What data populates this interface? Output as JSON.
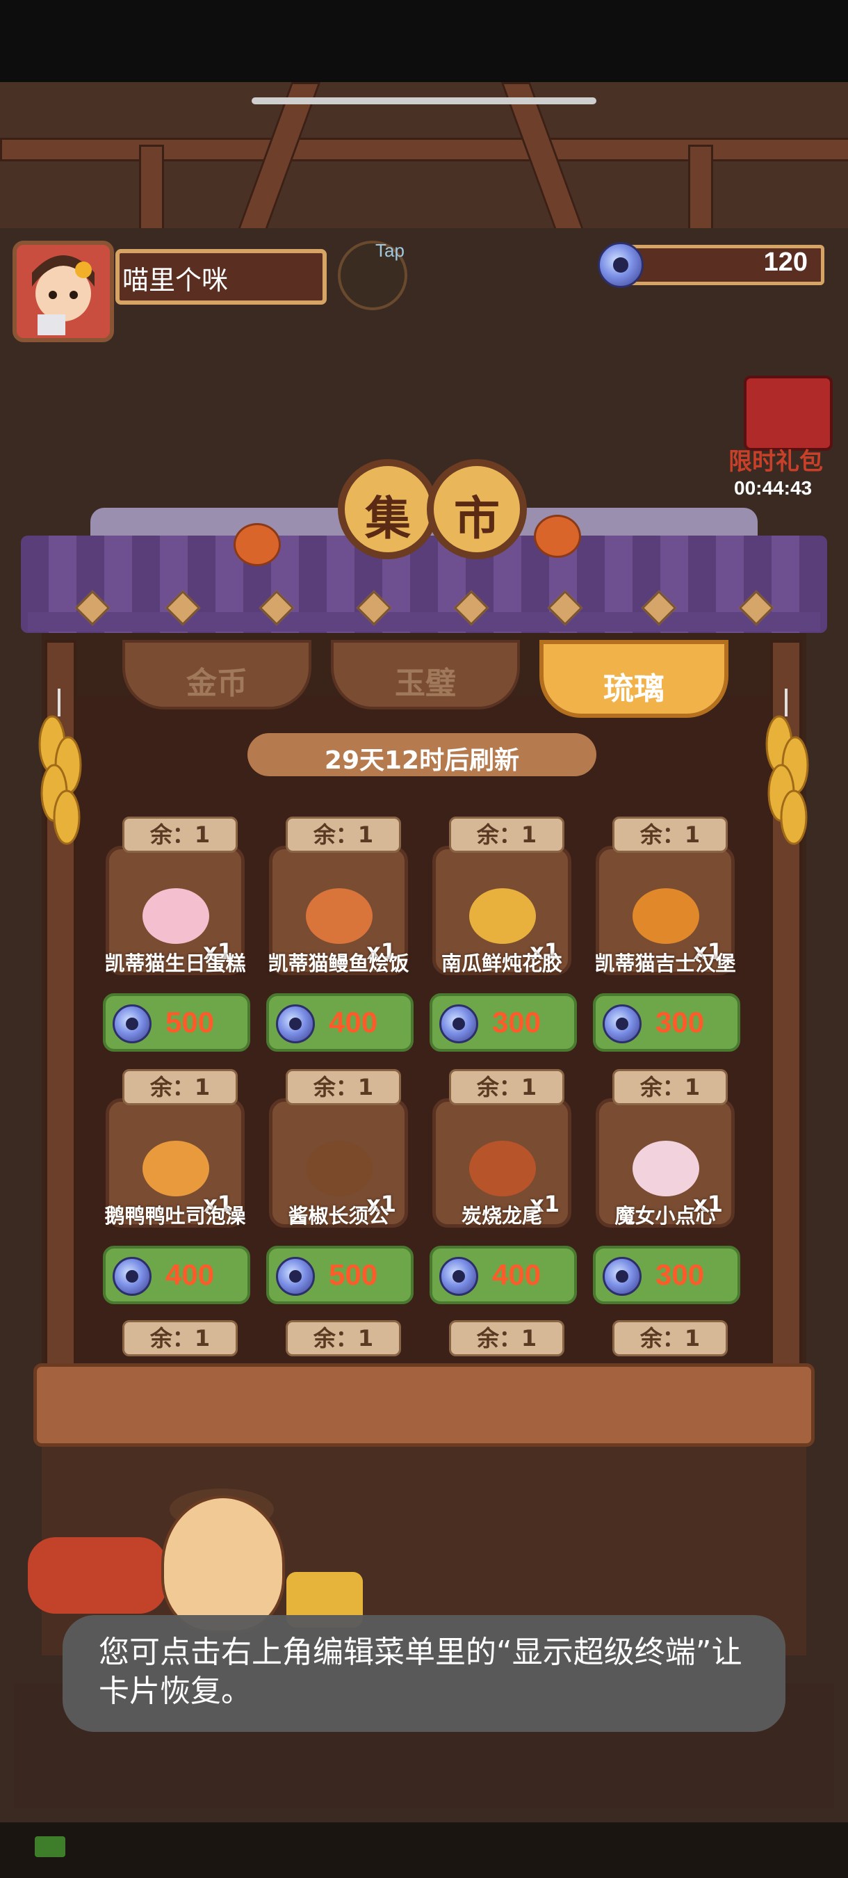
{
  "player": {
    "name": "喵里个咪",
    "tap_label": "Tap"
  },
  "currency": {
    "icon": "glass-coin-icon",
    "value": "120"
  },
  "gift": {
    "label": "限时礼包",
    "timer": "00:44:43"
  },
  "shop": {
    "title_chars": [
      "集",
      "市"
    ],
    "tabs": [
      {
        "label": "金币",
        "active": false
      },
      {
        "label": "玉璧",
        "active": false
      },
      {
        "label": "琉璃",
        "active": true
      }
    ],
    "refresh_text": "29天12时后刷新",
    "items": [
      {
        "stock": "余：1",
        "name": "凯蒂猫生日蛋糕",
        "qty": "x1",
        "price": "500",
        "food_color": "#f4c0cf"
      },
      {
        "stock": "余：1",
        "name": "凯蒂猫鳗鱼烩饭",
        "qty": "x1",
        "price": "400",
        "food_color": "#d9743a"
      },
      {
        "stock": "余：1",
        "name": "南瓜鲜炖花胶",
        "qty": "x1",
        "price": "300",
        "food_color": "#e8b03c"
      },
      {
        "stock": "余：1",
        "name": "凯蒂猫吉士汉堡",
        "qty": "x1",
        "price": "300",
        "food_color": "#e0882a"
      },
      {
        "stock": "余：1",
        "name": "鹅鸭鸭吐司泡澡",
        "qty": "x1",
        "price": "400",
        "food_color": "#e89a3c"
      },
      {
        "stock": "余：1",
        "name": "酱椒长须公",
        "qty": "x1",
        "price": "500",
        "food_color": "#7a4a2a"
      },
      {
        "stock": "余：1",
        "name": "炭烧龙尾",
        "qty": "x1",
        "price": "400",
        "food_color": "#b8542a"
      },
      {
        "stock": "余：1",
        "name": "魔女小点心",
        "qty": "x1",
        "price": "300",
        "food_color": "#f2d2dc"
      }
    ],
    "partial_row_stock": [
      "余：1",
      "余：1",
      "余：1",
      "余：1"
    ]
  },
  "toast": {
    "text": "您可点击右上角编辑菜单里的“显示超级终端”让卡片恢复。"
  },
  "colors": {
    "roof_purple": "#5a3e7a",
    "active_tab": "#f2b24a",
    "price_green": "#6ea64a",
    "price_text": "#ff5a2a"
  }
}
